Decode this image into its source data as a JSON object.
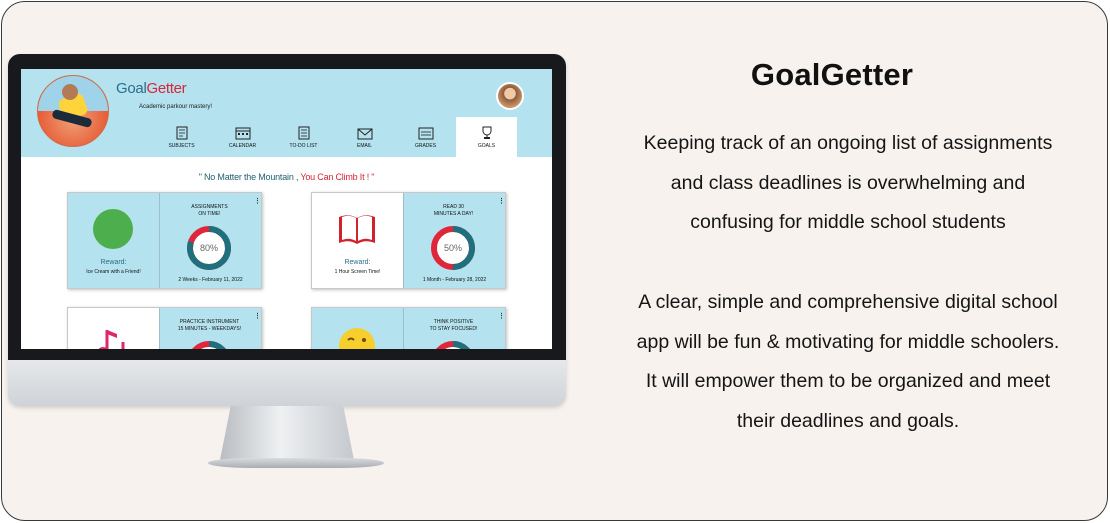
{
  "app": {
    "brand_part1": "Goal",
    "brand_part2": "Getter",
    "tagline": "Academic parkour mastery!",
    "nav": [
      {
        "label": "SUBJECTS",
        "icon": "subjects-icon"
      },
      {
        "label": "CALENDAR",
        "icon": "calendar-icon"
      },
      {
        "label": "TO-DO LIST",
        "icon": "todo-list-icon"
      },
      {
        "label": "EMAIL",
        "icon": "email-icon"
      },
      {
        "label": "GRADES",
        "icon": "grades-icon"
      },
      {
        "label": "GOALS",
        "icon": "goals-trophy-icon",
        "active": true
      }
    ],
    "quote_part1": "\" No Matter the Mountain , ",
    "quote_part2": "You Can Climb It ! \"",
    "cards": [
      {
        "goal_title": "ASSIGNMENTS\nON TIME!",
        "progress_label": "80%",
        "progress": 0.8,
        "period": "2 Weeks - February 11, 2022",
        "reward_title": "Reward:",
        "reward_text": "Ice Cream with a Friend!",
        "reward_icon": "green-circle-icon"
      },
      {
        "goal_title": "READ 30\nMINUTES A DAY!",
        "progress_label": "50%",
        "progress": 0.5,
        "period": "1 Month - February 28, 2022",
        "reward_title": "Reward:",
        "reward_text": "1 Hour Screen Time!",
        "reward_icon": "open-book-icon"
      },
      {
        "goal_title": "PRACTICE INSTRUMENT\n15 MINUTES - WEEKDAYS!",
        "progress": 0.6,
        "reward_icon": "music-notes-icon"
      },
      {
        "goal_title": "THINK POSITIVE\nTO STAY FOCUSED!",
        "progress": 0.6,
        "reward_icon": "winking-emoji-icon"
      }
    ],
    "colors": {
      "header_bg": "#b4e2ee",
      "brand_blue": "#2a6f8a",
      "brand_red": "#d9263a",
      "donut_teal": "#1f6f7c",
      "donut_red": "#e0263a"
    }
  },
  "description": {
    "heading": "GoalGetter",
    "paragraph1_lines": [
      "Keeping track of an ongoing list of assignments",
      "and class deadlines is overwhelming and",
      "confusing for middle school students"
    ],
    "paragraph2_lines": [
      "A clear, simple and comprehensive digital school",
      "app will be fun & motivating for middle schoolers.",
      "It will empower them to be organized and meet",
      "their deadlines and goals."
    ]
  }
}
